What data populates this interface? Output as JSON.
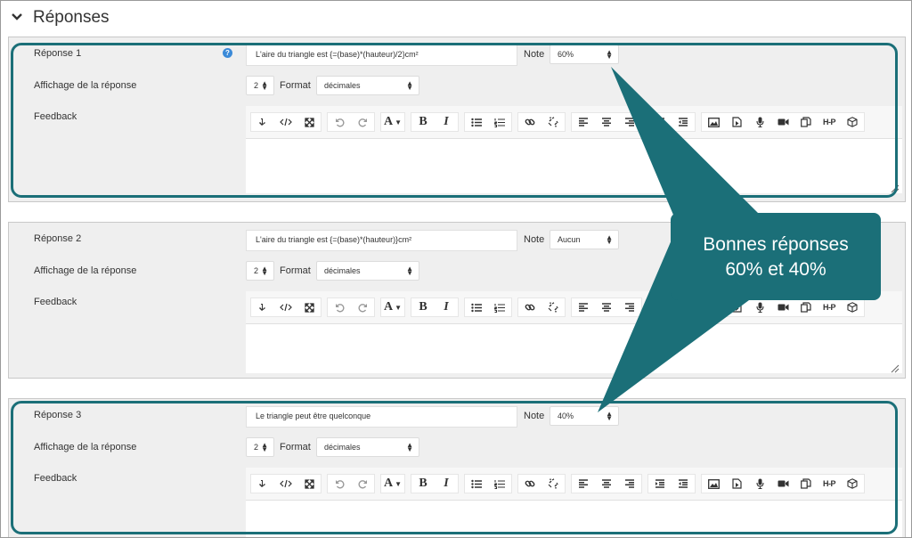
{
  "section": {
    "title": "Réponses"
  },
  "labels": {
    "answer_display": "Affichage de la réponse",
    "format": "Format",
    "feedback": "Feedback",
    "note": "Note"
  },
  "answers": [
    {
      "label": "Réponse 1",
      "value": "L'aire du triangle est {=(base)*(hauteur)/2}cm²",
      "note": "60%",
      "display_digits": "2",
      "format": "décimales"
    },
    {
      "label": "Réponse 2",
      "value": "L'aire du triangle est {=(base)*(hauteur)}cm²",
      "note": "Aucun",
      "display_digits": "2",
      "format": "décimales"
    },
    {
      "label": "Réponse 3",
      "value": "Le triangle peut être quelconque",
      "note": "40%",
      "display_digits": "2",
      "format": "décimales"
    }
  ],
  "help_icon": "?",
  "toolbar_icons": [
    "show-more-icon",
    "html-icon",
    "fullscreen-icon",
    "undo-icon",
    "redo-icon",
    "font-color-icon",
    "bold-icon",
    "italic-icon",
    "bullet-list-icon",
    "numbered-list-icon",
    "link-icon",
    "unlink-icon",
    "align-left-icon",
    "align-center-icon",
    "align-right-icon",
    "indent-icon",
    "outdent-icon",
    "image-icon",
    "media-icon",
    "record-audio-icon",
    "record-video-icon",
    "manage-files-icon",
    "h5p-icon",
    "content-bank-icon"
  ],
  "toolbar_glyphs": {
    "h5p": "H-P",
    "font": "A",
    "bold": "B",
    "italic": "I"
  },
  "callout": {
    "line1": "Bonnes réponses",
    "line2": "60% et 40%",
    "color": "#1b6f78"
  }
}
